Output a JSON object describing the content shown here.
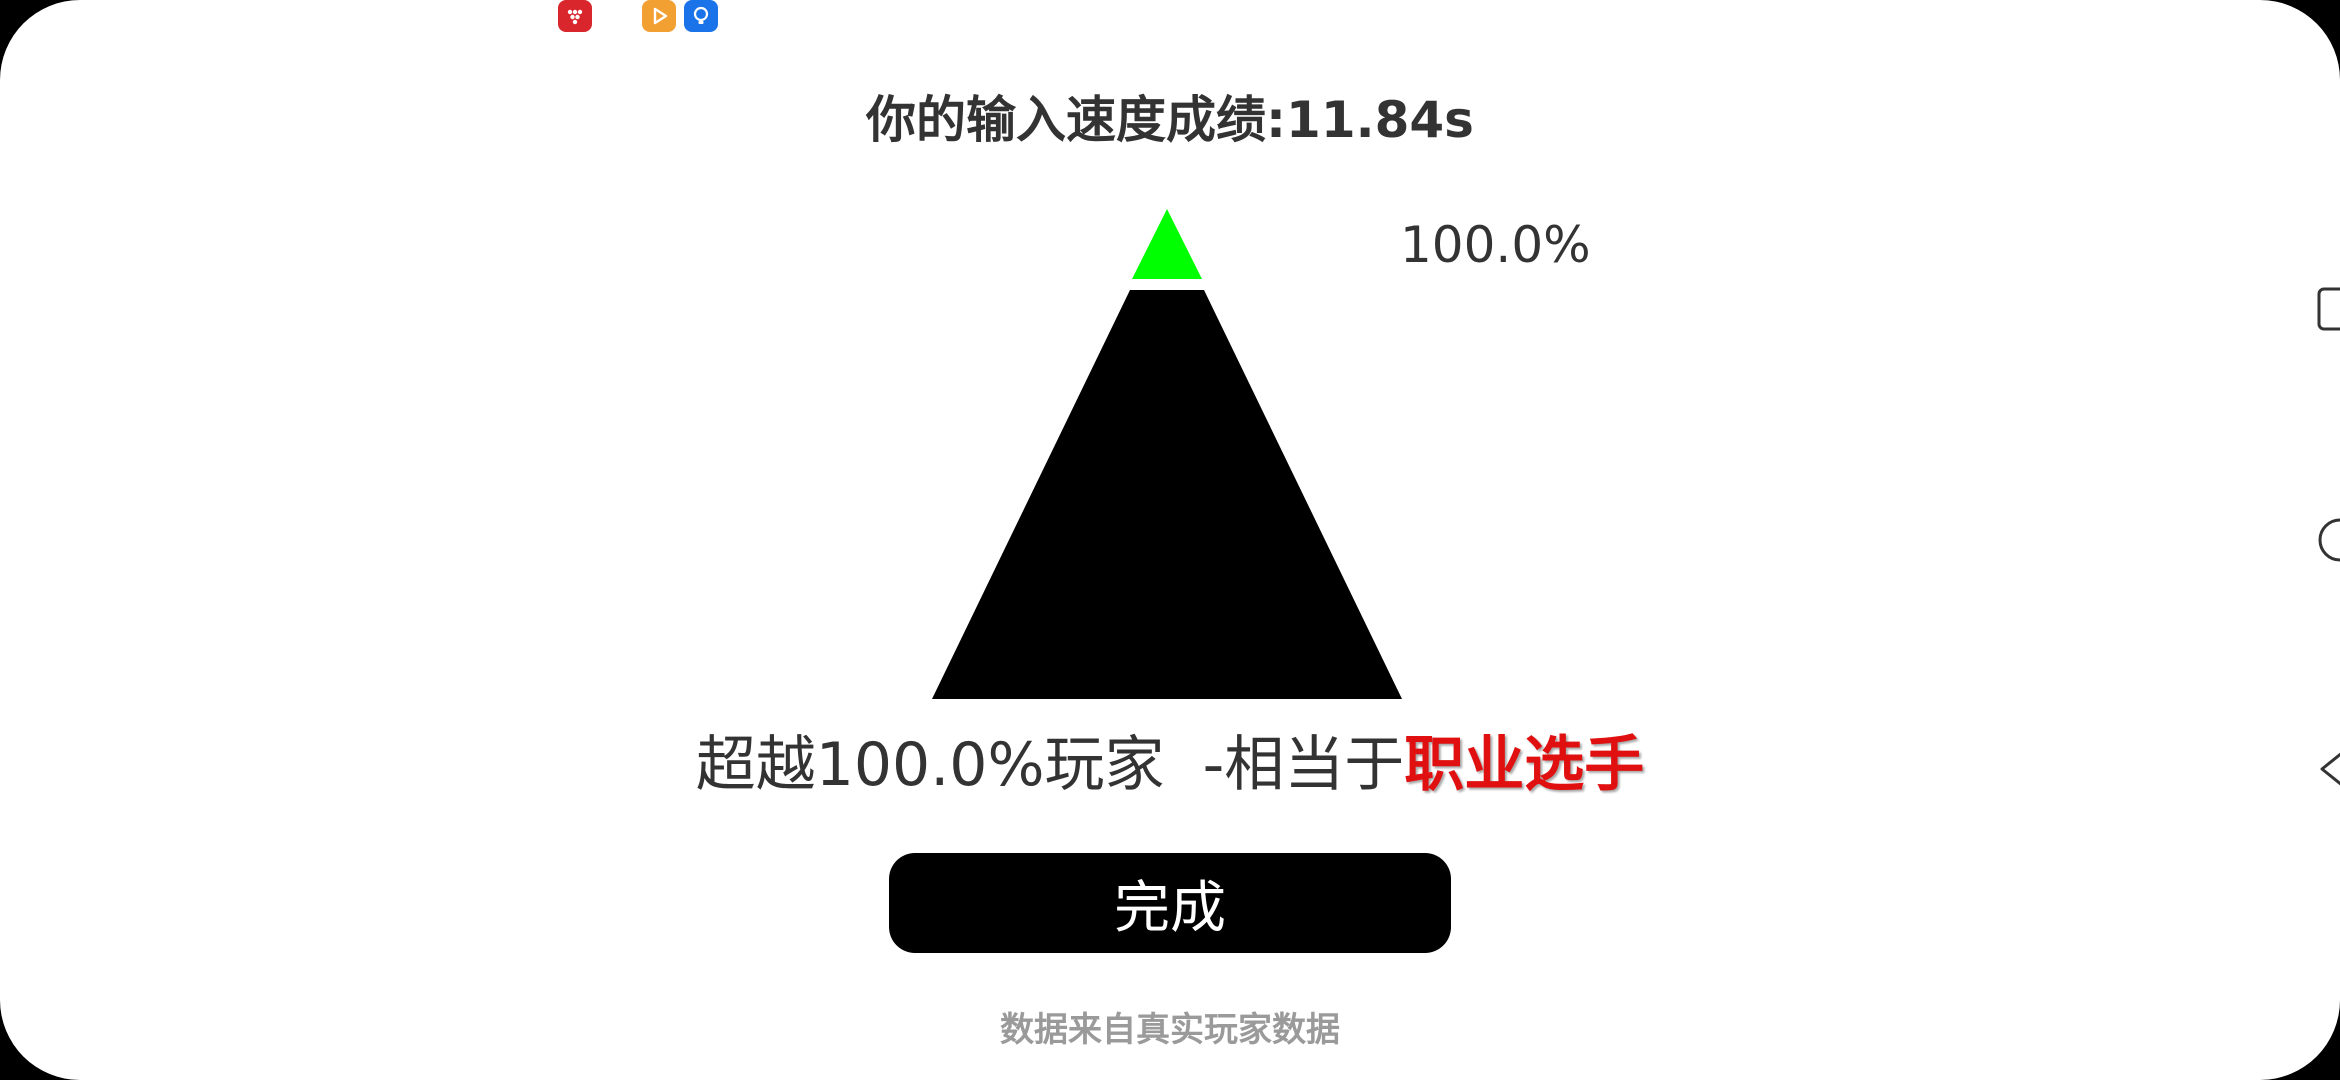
{
  "result": {
    "title": "你的输入速度成绩:11.84s",
    "percent_label": "100.0%",
    "summary_prefix": "超越100.0%玩家  -相当于",
    "rank": "职业选手",
    "done_button": "完成",
    "footer_note": "数据来自真实玩家数据",
    "percentile": 100.0
  },
  "colors": {
    "pyramid": "#000000",
    "pyramid_tip": "#00ff00",
    "rank": "#e01010",
    "footer": "#9a9a9a"
  },
  "status_bar": {
    "icons": [
      "app-icon-red",
      "app-icon-orange-play",
      "app-icon-blue-bulb"
    ]
  },
  "nav_bar": {
    "icons": [
      "recents-icon",
      "home-icon",
      "back-icon"
    ]
  }
}
